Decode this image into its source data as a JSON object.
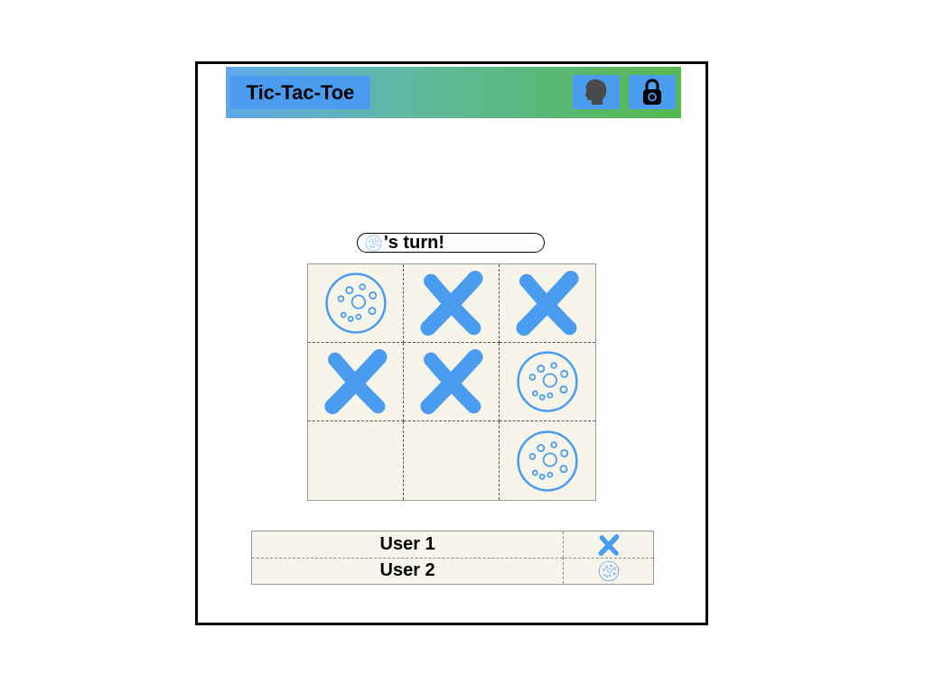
{
  "app": {
    "title": "Tic-Tac-Toe"
  },
  "header": {
    "user_button_icon": "user-head-icon",
    "lock_button_icon": "padlock-icon"
  },
  "turn": {
    "marker": "o",
    "text": "'s turn!"
  },
  "board": [
    [
      "o",
      "x",
      "x"
    ],
    [
      "x",
      "x",
      "o"
    ],
    [
      "",
      "",
      "o"
    ]
  ],
  "players": [
    {
      "name": "User 1",
      "marker": "x"
    },
    {
      "name": "User 2",
      "marker": "o"
    }
  ],
  "colors": {
    "marker_blue": "#4a9cf0",
    "board_bg": "#f7f5ea"
  }
}
